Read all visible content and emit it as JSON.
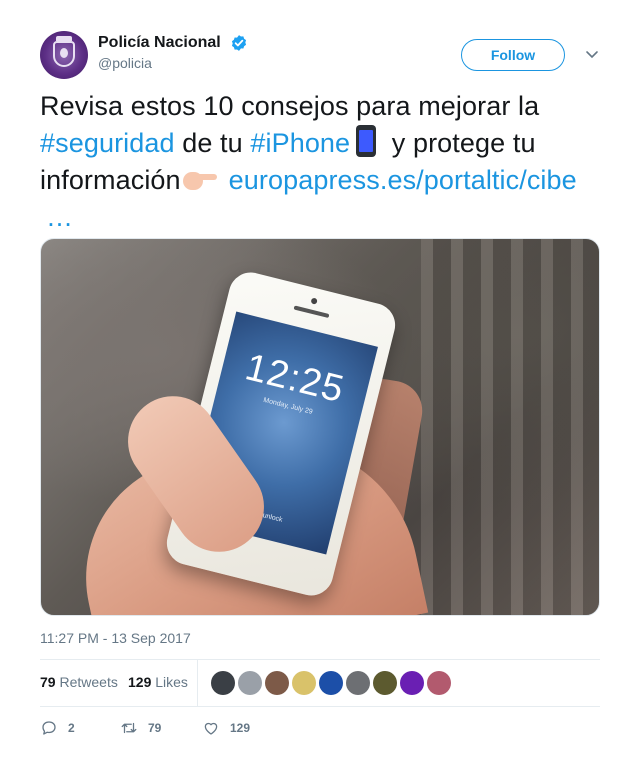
{
  "author": {
    "display_name": "Policía Nacional",
    "handle": "@policia",
    "verified": true,
    "avatar_icon": "police-crest-icon"
  },
  "follow_button": {
    "label": "Follow"
  },
  "tweet": {
    "segments": [
      {
        "type": "text",
        "value": "Revisa estos 10 consejos para mejorar la "
      },
      {
        "type": "hashtag",
        "value": "#seguridad"
      },
      {
        "type": "text",
        "value": " de tu "
      },
      {
        "type": "hashtag",
        "value": "#iPhone"
      },
      {
        "type": "emoji",
        "value": "mobile-phone-emoji"
      },
      {
        "type": "text",
        "value": " y protege tu información"
      },
      {
        "type": "emoji",
        "value": "pointing-hand-emoji"
      },
      {
        "type": "link",
        "value": "europapress.es/portaltic/cibe"
      },
      {
        "type": "ellipsis",
        "value": "…"
      }
    ]
  },
  "photo": {
    "lock_time": "12:25",
    "lock_date": "Monday, July 29",
    "lock_hint": "slide to unlock"
  },
  "timestamp": "11:27 PM - 13 Sep 2017",
  "stats": {
    "retweets_count": "79",
    "retweets_label": "Retweets",
    "likes_count": "129",
    "likes_label": "Likes"
  },
  "likers_colors": [
    "#3a3f45",
    "#9aa0a8",
    "#7d5a48",
    "#d9c26a",
    "#1c4fa8",
    "#6d6f73",
    "#5c5a2f",
    "#6a1fb3",
    "#b25a6e"
  ],
  "actions": {
    "reply_count": "2",
    "retweet_count": "79",
    "like_count": "129"
  },
  "colors": {
    "accent": "#1b95e0",
    "text": "#14171a",
    "muted": "#657786",
    "verified": "#1da1f2"
  }
}
